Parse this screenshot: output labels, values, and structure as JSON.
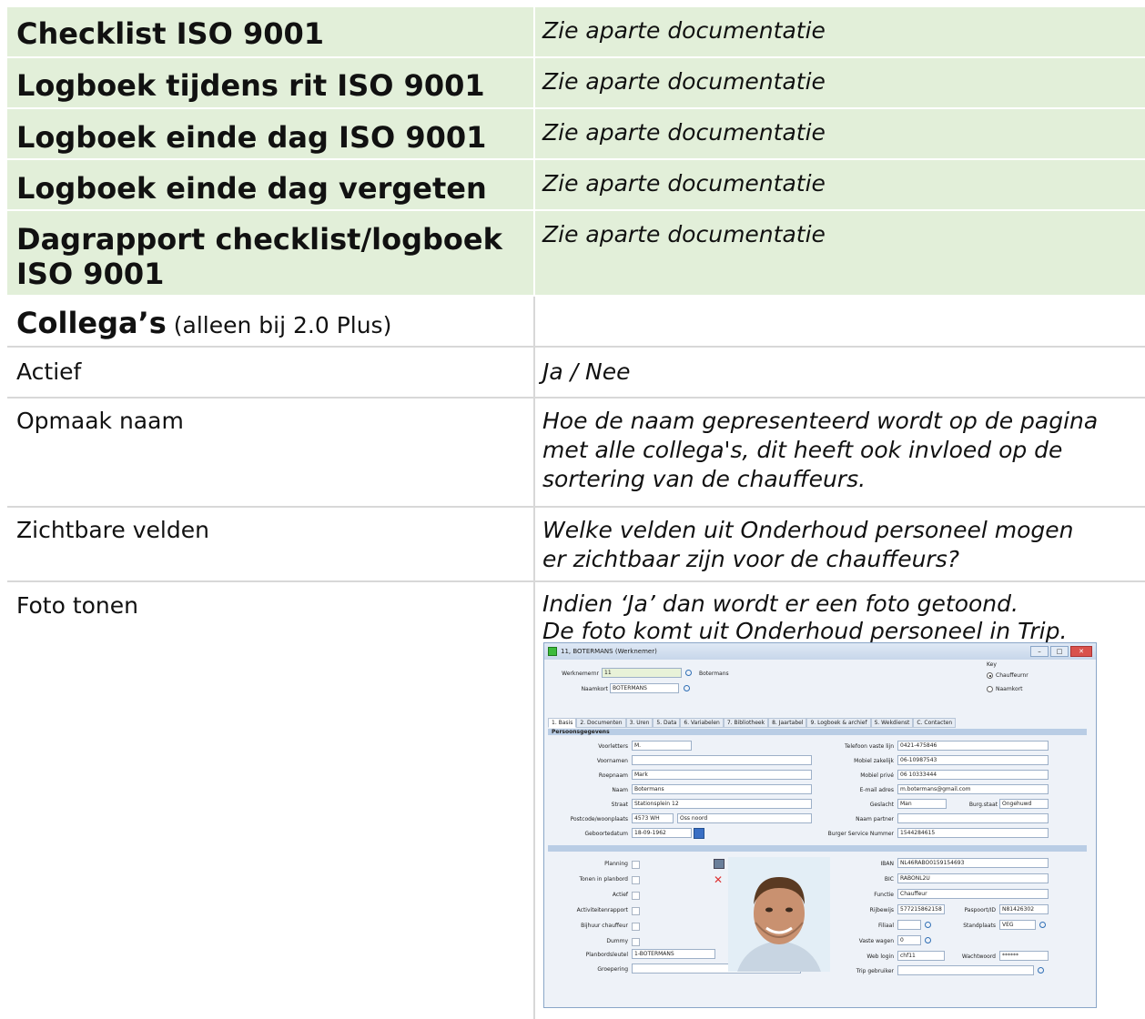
{
  "doc": {
    "green_rows": [
      {
        "label": "Checklist ISO 9001",
        "desc": "Zie aparte documentatie"
      },
      {
        "label": "Logboek tijdens rit ISO 9001",
        "desc": "Zie aparte documentatie"
      },
      {
        "label": "Logboek einde dag ISO 9001",
        "desc": "Zie aparte documentatie"
      },
      {
        "label": "Logboek einde dag vergeten",
        "desc": "Zie aparte documentatie"
      },
      {
        "label_line1": "Dagrapport checklist/logboek",
        "label_line2": "ISO 9001",
        "desc": "Zie aparte documentatie"
      }
    ],
    "section": {
      "title": "Collega’s",
      "note": " (alleen bij 2.0 Plus)"
    },
    "rows": [
      {
        "label": "Actief",
        "desc": "Ja / Nee"
      },
      {
        "label": "Opmaak naam",
        "desc_l1": "Hoe de naam gepresenteerd wordt op de pagina",
        "desc_l2": "met alle collega's, dit heeft ook invloed op de",
        "desc_l3": "sortering van de chauffeurs."
      },
      {
        "label": "Zichtbare velden",
        "desc_l1": "Welke velden uit Onderhoud personeel mogen",
        "desc_l2": "er zichtbaar zijn voor de chauffeurs?"
      },
      {
        "label": "Foto tonen",
        "desc_l1": "Indien ‘Ja’ dan wordt er een foto getoond.",
        "desc_l2": "De foto komt uit Onderhoud personeel in Trip."
      }
    ]
  },
  "window": {
    "title": "11, BOTERMANS (Werknemer)",
    "werknemernr_label": "Werknemernr",
    "werknemernr_value": "11",
    "name_display": "Botermans",
    "naamkort_label": "Naamkort",
    "naamkort_value": "BOTERMANS",
    "key_label": "Key",
    "key_option1": "Chauffeurnr",
    "key_option2": "Naamkort",
    "tabs": [
      "1. Basis",
      "2. Documenten",
      "3. Uren",
      "5. Data",
      "6. Variabelen",
      "7. Bibliotheek",
      "8. Jaartabel",
      "9. Logboek & archief",
      "S. Wekdienst",
      "C. Contacten"
    ],
    "section_label": "Persoonsgegevens",
    "left_fields": [
      {
        "label": "Voorletters",
        "value": "M."
      },
      {
        "label": "Voornamen",
        "value": ""
      },
      {
        "label": "Roepnaam",
        "value": "Mark"
      },
      {
        "label": "Naam",
        "value": "Botermans"
      },
      {
        "label": "Straat",
        "value": "Stationsplein 12"
      },
      {
        "label": "Postcode/woonplaats",
        "value": "4573 WH",
        "value2": "Oss noord"
      },
      {
        "label": "Geboortedatum",
        "value": "18-09-1962"
      }
    ],
    "right_fields": [
      {
        "label": "Telefoon vaste lijn",
        "value": "0421-475846"
      },
      {
        "label": "Mobiel zakelijk",
        "value": "06-10987543"
      },
      {
        "label": "Mobiel privé",
        "value": "06 10333444"
      },
      {
        "label": "E-mail adres",
        "value": "m.botermans@gmail.com"
      },
      {
        "label": "Geslacht",
        "value": "Man",
        "label2": "Burg.staat",
        "value2": "Ongehuwd"
      },
      {
        "label": "Naam partner",
        "value": ""
      },
      {
        "label": "Burger Service Nummer",
        "value": "1544284615"
      }
    ],
    "checks": [
      "Planning",
      "Tonen in planbord",
      "Actief",
      "Activiteitenrapport",
      "Bijhuur chauffeur",
      "Dummy"
    ],
    "planbordsleutel_label": "Planbordsleutel",
    "planbordsleutel_value": "1-BOTERMANS",
    "groepering_label": "Groepering",
    "lower_right": [
      {
        "label": "IBAN",
        "value": "NL46RABO0159154693"
      },
      {
        "label": "BIC",
        "value": "RABONL2U"
      },
      {
        "label": "Functie",
        "value": "Chauffeur"
      },
      {
        "label": "Rijbewijs",
        "value": "577215862158",
        "label2": "Paspoort/ID",
        "value2": "N81426302"
      },
      {
        "label": "Filiaal",
        "value": "",
        "label2": "Standplaats",
        "value2": "VEG"
      },
      {
        "label": "Vaste wagen",
        "value": "0"
      },
      {
        "label": "Web login",
        "value": "chf11",
        "label2": "Wachtwoord",
        "value2": "******"
      },
      {
        "label": "Trip gebruiker",
        "value": ""
      }
    ]
  }
}
